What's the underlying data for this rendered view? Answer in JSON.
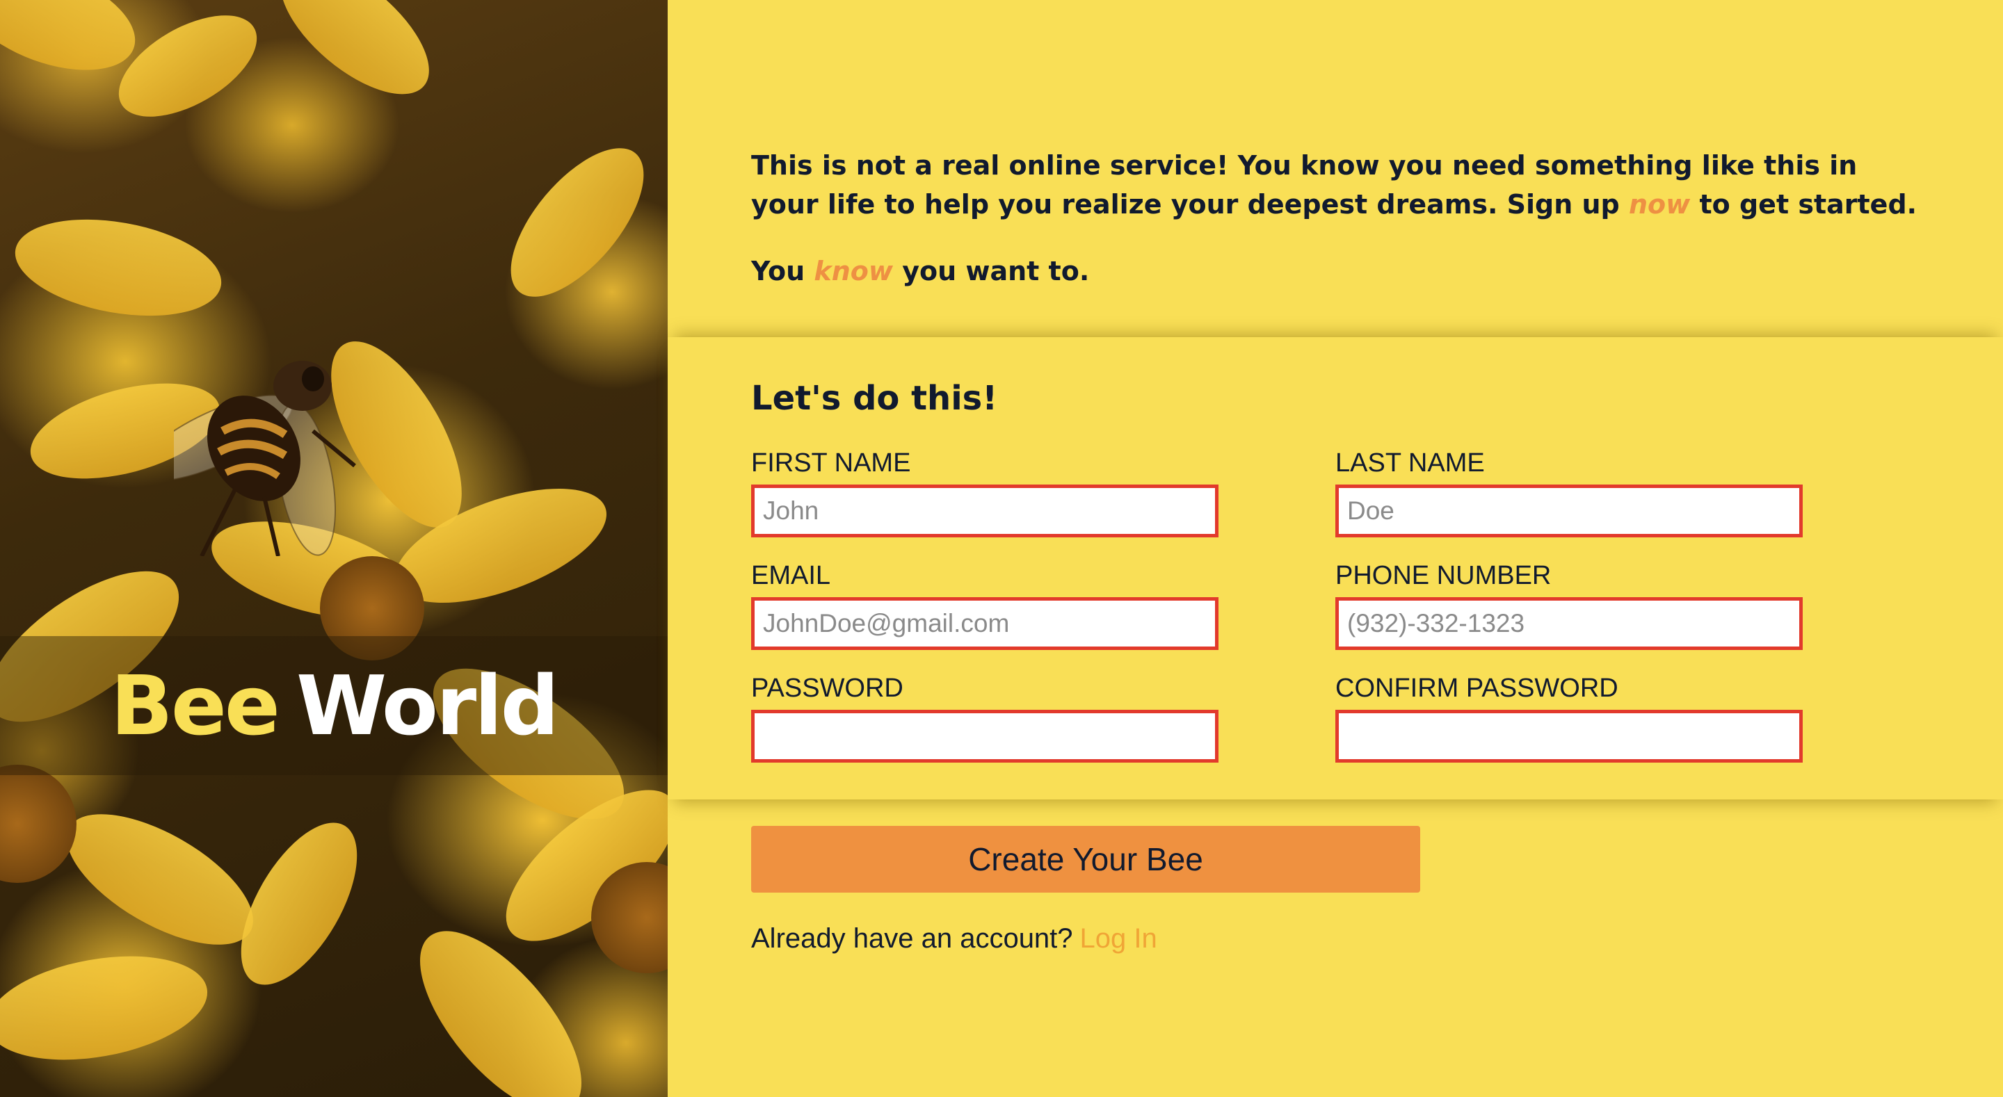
{
  "hero": {
    "title_part1": "Bee",
    "title_part2": "World",
    "image": "bee-on-yellow-flowers"
  },
  "intro": {
    "p1_before": "This is not a real online service! You know you need something like this in your life to help you realize your deepest dreams. Sign up ",
    "p1_accent": "now",
    "p1_after": " to get started.",
    "p2_before": "You ",
    "p2_accent": "know",
    "p2_after": " you want to."
  },
  "form": {
    "title": "Let's do this!",
    "first_name": {
      "label": "FIRST NAME",
      "placeholder": "John",
      "value": ""
    },
    "last_name": {
      "label": "LAST NAME",
      "placeholder": "Doe",
      "value": ""
    },
    "email": {
      "label": "EMAIL",
      "placeholder": "JohnDoe@gmail.com",
      "value": ""
    },
    "phone": {
      "label": "PHONE NUMBER",
      "placeholder": "(932)-332-1323",
      "value": ""
    },
    "password": {
      "label": "PASSWORD",
      "placeholder": "",
      "value": ""
    },
    "confirm_password": {
      "label": "CONFIRM PASSWORD",
      "placeholder": "",
      "value": ""
    }
  },
  "actions": {
    "submit_label": "Create Your Bee",
    "login_prompt": "Already have an account?",
    "login_link": "Log In"
  },
  "colors": {
    "background": "#f9df56",
    "accent": "#ee9043",
    "button": "#ef9140",
    "input_border": "#e23a2c",
    "text": "#111a2e",
    "link": "#f0a536"
  }
}
